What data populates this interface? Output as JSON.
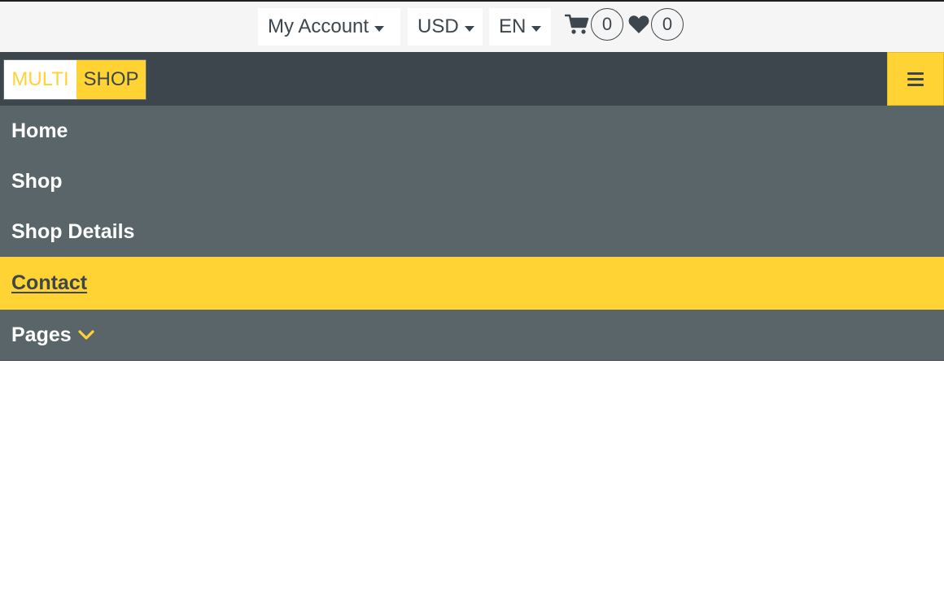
{
  "topbar": {
    "account": {
      "label": "My Account"
    },
    "currency": {
      "label": "USD"
    },
    "language": {
      "label": "EN"
    },
    "cart": {
      "icon": "cart-icon",
      "count": "0"
    },
    "wishlist": {
      "icon": "heart-icon",
      "count": "0"
    }
  },
  "brand": {
    "part1": "MULTI",
    "part2": "SHOP"
  },
  "navbar": {
    "toggler_icon": "hamburger-icon"
  },
  "menu": {
    "items": [
      {
        "label": "Home"
      },
      {
        "label": "Shop"
      },
      {
        "label": "Shop Details"
      },
      {
        "label": "Contact",
        "active": true
      },
      {
        "label": "Pages",
        "icon": "chevron-down-icon"
      }
    ]
  },
  "colors": {
    "accent": "#ffd333",
    "dark": "#3d464d",
    "menu_bg": "#5a6569",
    "topbar_bg": "#f5f5f5"
  }
}
